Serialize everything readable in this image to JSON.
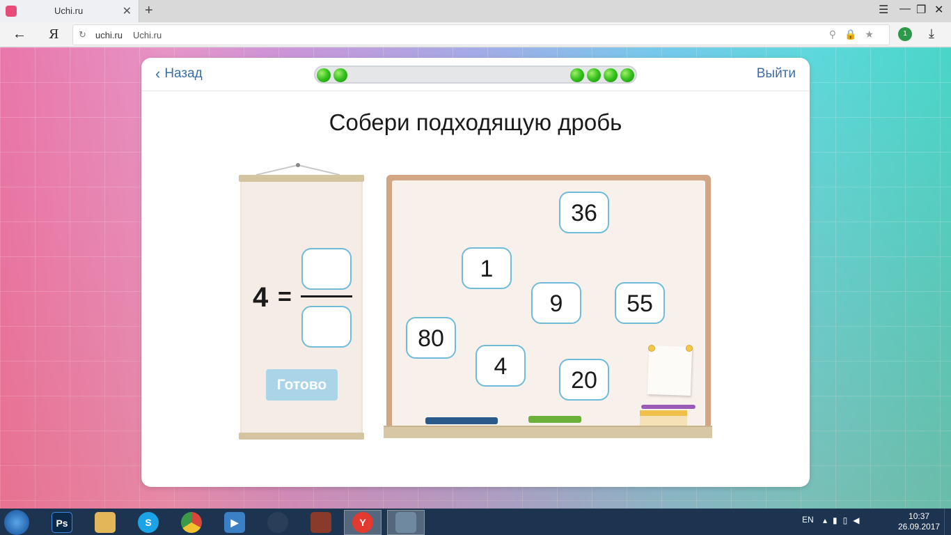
{
  "browser": {
    "tab_title": "Uchi.ru",
    "tab_close": "✕",
    "new_tab": "+",
    "window_controls": [
      "☰",
      "—",
      "❐",
      "✕"
    ],
    "back": "←",
    "ya_logo": "Я",
    "reload": "↻",
    "url_domain": "uchi.ru",
    "url_title": "Uchi.ru",
    "url_icons": "⚲🔒★",
    "download": "⤓",
    "ext_badge": "1"
  },
  "card": {
    "back_label": "Назад",
    "back_chevron": "‹",
    "exit_label": "Выйти",
    "title": "Собери подходящую дробь",
    "progress": {
      "left_dots": 2,
      "right_dots": 4
    }
  },
  "equation": {
    "whole": "4",
    "sign": "=",
    "done_label": "Готово"
  },
  "tiles": [
    "36",
    "1",
    "9",
    "55",
    "80",
    "4",
    "20"
  ],
  "taskbar": {
    "apps": [
      {
        "name": "explorer",
        "label": "",
        "color": "#e8c04a"
      },
      {
        "name": "photoshop",
        "label": "Ps",
        "color": "#0b2a4a"
      },
      {
        "name": "file-manager",
        "label": "",
        "color": "#e2b659"
      },
      {
        "name": "skype",
        "label": "S",
        "color": "#1aa3e6"
      },
      {
        "name": "chrome",
        "label": "",
        "color": "#d9473a"
      },
      {
        "name": "media-player",
        "label": "▶",
        "color": "#3b7fc4"
      },
      {
        "name": "steam",
        "label": "",
        "color": "#2a3e5a"
      },
      {
        "name": "app-red",
        "label": "",
        "color": "#8a3a2a"
      },
      {
        "name": "yandex-browser",
        "label": "Y",
        "color": "#e23a2e"
      },
      {
        "name": "monitor-app",
        "label": "",
        "color": "#6f8aa0"
      }
    ],
    "lang": "EN",
    "tray_icons": "▴▮▯◀",
    "time": "10:37",
    "date": "26.09.2017"
  }
}
